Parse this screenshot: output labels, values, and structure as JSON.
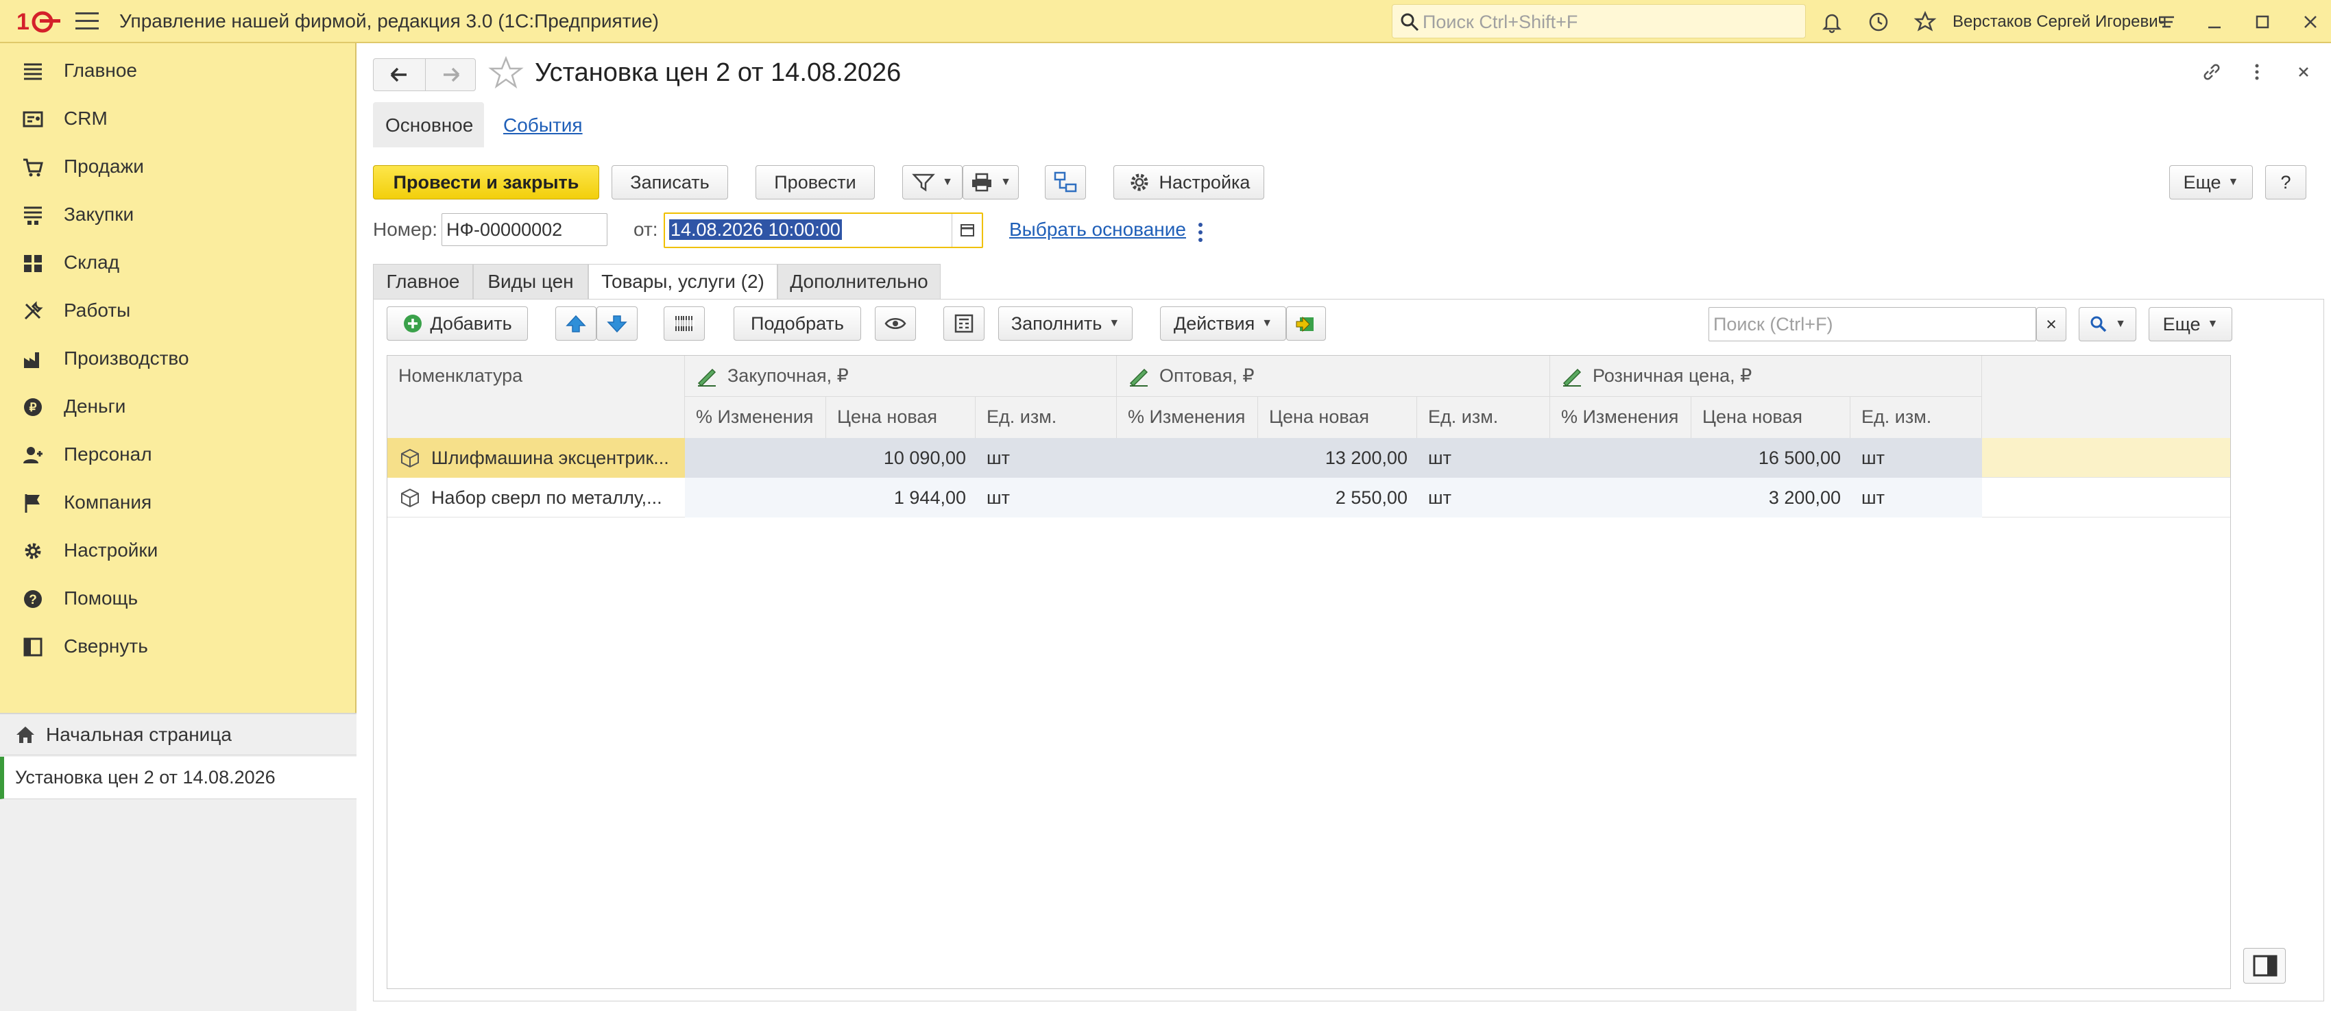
{
  "app": {
    "title": "Управление нашей фирмой, редакция 3.0  (1С:Предприятие)",
    "search_placeholder": "Поиск Ctrl+Shift+F",
    "user": "Верстаков Сергей Игоревич",
    "accent": "#fbed9e"
  },
  "sidebar": {
    "items": [
      {
        "label": "Главное",
        "icon": "menu-lines-icon"
      },
      {
        "label": "CRM",
        "icon": "crm-icon"
      },
      {
        "label": "Продажи",
        "icon": "sales-icon"
      },
      {
        "label": "Закупки",
        "icon": "purchases-icon"
      },
      {
        "label": "Склад",
        "icon": "warehouse-icon"
      },
      {
        "label": "Работы",
        "icon": "tools-icon"
      },
      {
        "label": "Производство",
        "icon": "factory-icon"
      },
      {
        "label": "Деньги",
        "icon": "money-icon"
      },
      {
        "label": "Персонал",
        "icon": "staff-icon"
      },
      {
        "label": "Компания",
        "icon": "flag-icon"
      },
      {
        "label": "Настройки",
        "icon": "gear-icon"
      },
      {
        "label": "Помощь",
        "icon": "help-icon"
      },
      {
        "label": "Свернуть",
        "icon": "collapse-icon"
      }
    ],
    "home": "Начальная страница",
    "open_doc": "Установка цен 2 от 14.08.2026"
  },
  "doc": {
    "title": "Установка цен 2 от 14.08.2026",
    "tab_main": "Основное",
    "tab_events": "События"
  },
  "toolbar": {
    "post_close": "Провести и закрыть",
    "save": "Записать",
    "post": "Провести",
    "settings": "Настройка",
    "more": "Еще",
    "help": "?"
  },
  "fields": {
    "number_label": "Номер:",
    "number_value": "НФ-00000002",
    "date_label": "от:",
    "date_value": "14.08.2026 10:00:00",
    "basis_link": "Выбрать основание"
  },
  "page_tabs": [
    "Главное",
    "Виды цен",
    "Товары, услуги (2)",
    "Дополнительно"
  ],
  "table_toolbar": {
    "add": "Добавить",
    "pick": "Подобрать",
    "fill": "Заполнить",
    "actions": "Действия",
    "search_placeholder": "Поиск (Ctrl+F)",
    "clear": "×",
    "more": "Еще"
  },
  "table": {
    "col_item": "Номенклатура",
    "groups": [
      "Закупочная, ₽",
      "Оптовая, ₽",
      "Розничная цена, ₽"
    ],
    "sub_change": "% Изменения",
    "sub_price": "Цена новая",
    "sub_unit": "Ед. изм.",
    "rows": [
      {
        "item": "Шлифмашина эксцентрик...",
        "p1": "10 090,00",
        "u1": "шт",
        "p2": "13 200,00",
        "u2": "шт",
        "p3": "16 500,00",
        "u3": "шт"
      },
      {
        "item": "Набор сверл по металлу,...",
        "p1": "1 944,00",
        "u1": "шт",
        "p2": "2 550,00",
        "u2": "шт",
        "p3": "3 200,00",
        "u3": "шт"
      }
    ]
  }
}
